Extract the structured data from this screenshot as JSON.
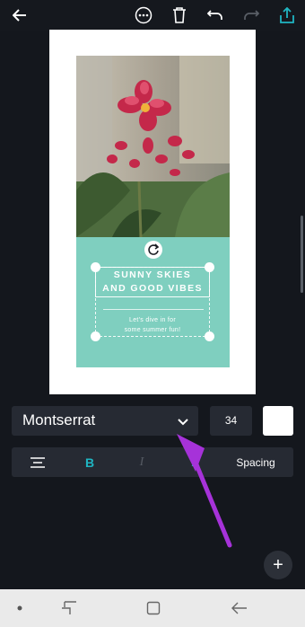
{
  "toolbar": {
    "back_icon": "arrow-left-icon",
    "more_icon": "more-options-icon",
    "delete_icon": "trash-icon",
    "undo_icon": "undo-icon",
    "redo_icon": "redo-icon",
    "share_icon": "share-upload-icon",
    "accent": "#1fb5c2"
  },
  "canvas": {
    "heading_line_1": "SUNNY SKIES",
    "heading_line_2": "AND GOOD VIBES",
    "body_line_1": "Let's dive in for",
    "body_line_2": "some summer fun!",
    "teal_color": "#7fcfbf"
  },
  "text_controls": {
    "font_name": "Montserrat",
    "font_size": "34",
    "text_color": "#ffffff"
  },
  "format_bar": {
    "bold_label": "B",
    "italic_label": "I",
    "color_label": "A",
    "spacing_label": "Spacing"
  },
  "fab": {
    "label": "+"
  },
  "navbar": {
    "items": [
      "dot-icon",
      "recent-apps-icon",
      "home-icon",
      "back-icon"
    ]
  }
}
